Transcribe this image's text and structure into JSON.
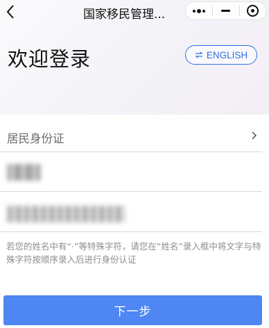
{
  "titlebar": {
    "title": "国家移民管理...",
    "menu_icon": "more-dots-icon",
    "minimize_icon": "minus-icon",
    "close_icon": "target-close-icon"
  },
  "welcome": {
    "heading": "欢迎登录",
    "language_button": "ENGLISH",
    "language_icon": "swap-arrows-icon"
  },
  "form": {
    "id_type": {
      "label": "居民身份证",
      "icon": "chevron-right-icon"
    },
    "name_field": {
      "value_obscured": true
    },
    "id_number_field": {
      "value_obscured": true
    },
    "hint": "若您的姓名中有“·”等特殊字符，请您在“姓名”录入框中将文字与特殊字符按顺序录入后进行身份认证"
  },
  "actions": {
    "next_label": "下一步"
  },
  "colors": {
    "accent": "#4e86f4",
    "link_blue": "#2d6fe8"
  }
}
